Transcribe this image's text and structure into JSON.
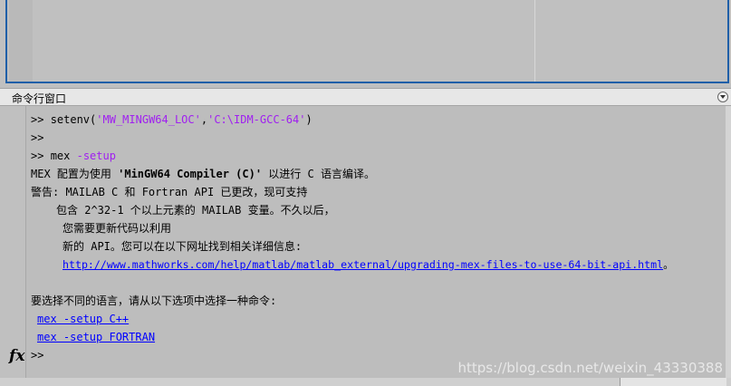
{
  "header": {
    "title": "命令行窗口"
  },
  "prompt": ">>",
  "lines": {
    "l1": {
      "cmd": "setenv(",
      "arg1": "'MW_MINGW64_LOC'",
      "comma": ",",
      "arg2": "'C:\\IDM-GCC-64'",
      "close": ")"
    },
    "l3": {
      "cmd": "mex",
      "opt": "-setup"
    },
    "l4": {
      "a": "MEX 配置为使用 ",
      "b": "'MinGW64 Compiler (C)'",
      "c": " 以进行 C 语言编译。"
    },
    "l5": "警告: MAILAB C 和 Fortran API 已更改，现可支持",
    "l6": "包含 2^32-1 个以上元素的 MAILAB 变量。不久以后，",
    "l7": "您需要更新代码以利用",
    "l8": "新的 API。您可以在以下网址找到相关详细信息:",
    "l9": {
      "link": "http://www.mathworks.com/help/matlab/matlab_external/upgrading-mex-files-to-use-64-bit-api.html",
      "after": "。"
    },
    "l11": "要选择不同的语言，请从以下选项中选择一种命令:",
    "l12": "mex -setup C++",
    "l13": "mex -setup FORTRAN"
  },
  "fx_icon_label": "fx",
  "watermark": "https://blog.csdn.net/weixin_43330388"
}
